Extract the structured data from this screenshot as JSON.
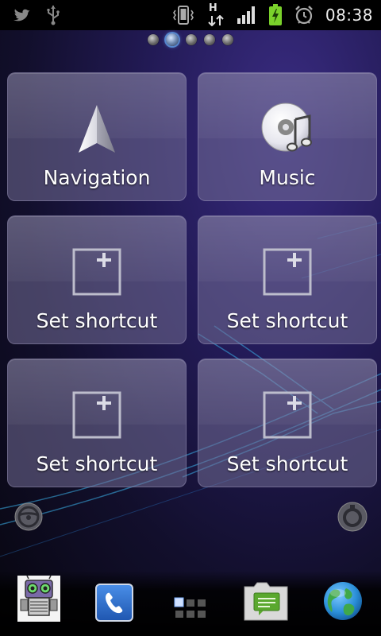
{
  "statusbar": {
    "icons_left": [
      "twitter-icon",
      "usb-icon"
    ],
    "icons_right": [
      "vibrate-icon",
      "hspa-data-icon",
      "signal-icon",
      "battery-charging-icon",
      "alarm-icon"
    ],
    "network_label": "H",
    "time": "08:38",
    "colors": {
      "battery": "#7ad12b",
      "background": "#000000"
    }
  },
  "pager": {
    "pages": 5,
    "active_index": 1
  },
  "tiles": [
    {
      "label": "Navigation",
      "icon": "navigation-arrow-icon"
    },
    {
      "label": "Music",
      "icon": "music-disc-icon"
    },
    {
      "label": "Set shortcut",
      "icon": "add-shortcut-icon"
    },
    {
      "label": "Set shortcut",
      "icon": "add-shortcut-icon"
    },
    {
      "label": "Set shortcut",
      "icon": "add-shortcut-icon"
    },
    {
      "label": "Set shortcut",
      "icon": "add-shortcut-icon"
    }
  ],
  "side_buttons": {
    "left": "steering-wheel-icon",
    "right": "settings-gear-icon"
  },
  "dock": {
    "items": [
      "robot-app-icon",
      "phone-icon",
      "app-drawer-icon",
      "messaging-icon",
      "browser-globe-icon"
    ],
    "colors": {
      "phone": "#2d6fd0",
      "messaging": "#5aa82e",
      "globe": "#2a8fd8"
    }
  }
}
